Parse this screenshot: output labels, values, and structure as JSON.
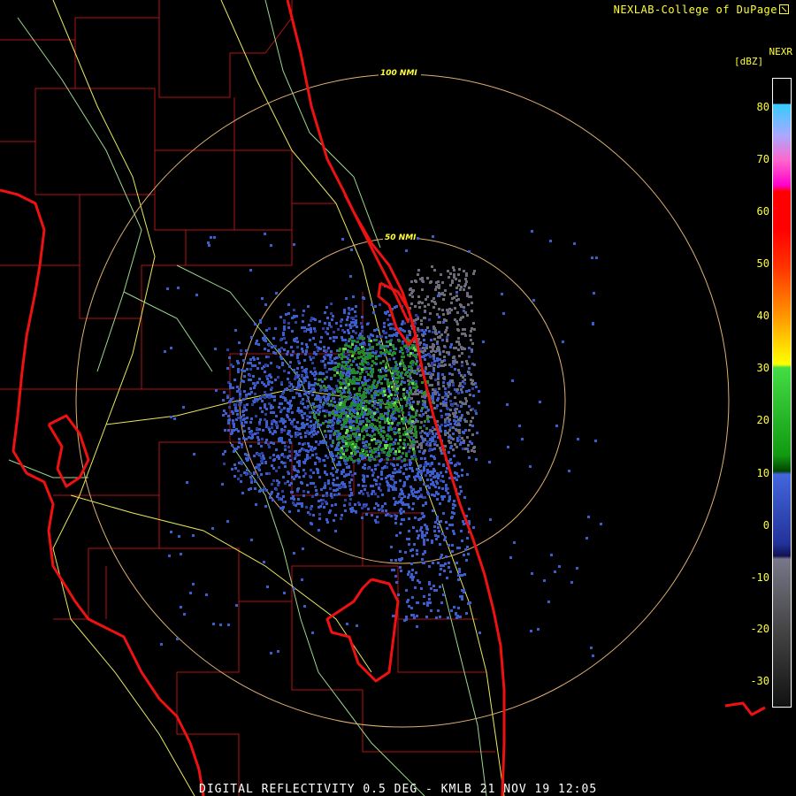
{
  "credit": "NEXLAB-College of DuPage",
  "scale": {
    "title": "NEXR",
    "unit": "[dBZ]",
    "ticks": [
      "80",
      "70",
      "60",
      "50",
      "40",
      "30",
      "20",
      "10",
      "0",
      "-10",
      "-20",
      "-30"
    ],
    "colors": [
      "#00ffff",
      "#ff66ff",
      "#ff00ff",
      "#ff0000",
      "#ff5500",
      "#ff9900",
      "#ffff00",
      "#33cc33",
      "#008800",
      "#3366cc",
      "#223399",
      "#777777",
      "#333333",
      "#111111"
    ]
  },
  "rings": [
    {
      "label": "100 NMI"
    },
    {
      "label": "50 NMI"
    }
  ],
  "footer": "DIGITAL REFLECTIVITY 0.5 DEG - KMLB 21 NOV 19 12:05"
}
